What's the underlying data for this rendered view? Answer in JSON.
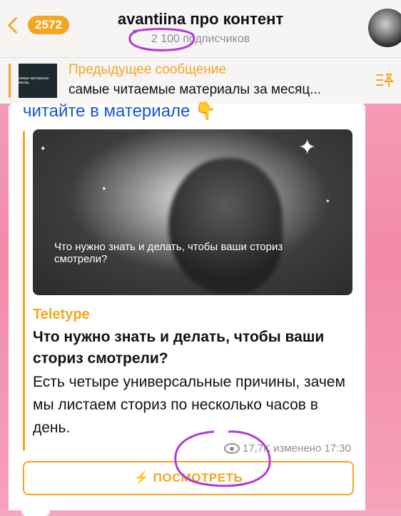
{
  "header": {
    "unread_count": "2572",
    "title": "avantiina про контент",
    "subscribers": "2 100 подписчиков"
  },
  "pinned": {
    "title": "Предыдущее сообщение",
    "text": "самые читаемые материалы за месяц...",
    "thumb_text": "самые материалы месяц"
  },
  "message": {
    "top_line": "читайте в материале 👇",
    "image_caption": "Что нужно знать и делать, чтобы ваши сториз смотрели?",
    "site_name": "Teletype",
    "article_title": "Что нужно знать и делать, чтобы ваши сториз смотрели?",
    "article_desc": "Есть четыре универсальные причины, зачем мы листаем сториз по несколько часов в день.",
    "views": "17,7K",
    "edited_time": "изменено 17:30",
    "button_label": "⚡ ПОСМОТРЕТЬ"
  },
  "colors": {
    "accent": "#f3a622",
    "link": "#1a55c6",
    "annotation": "#b23cd0"
  }
}
